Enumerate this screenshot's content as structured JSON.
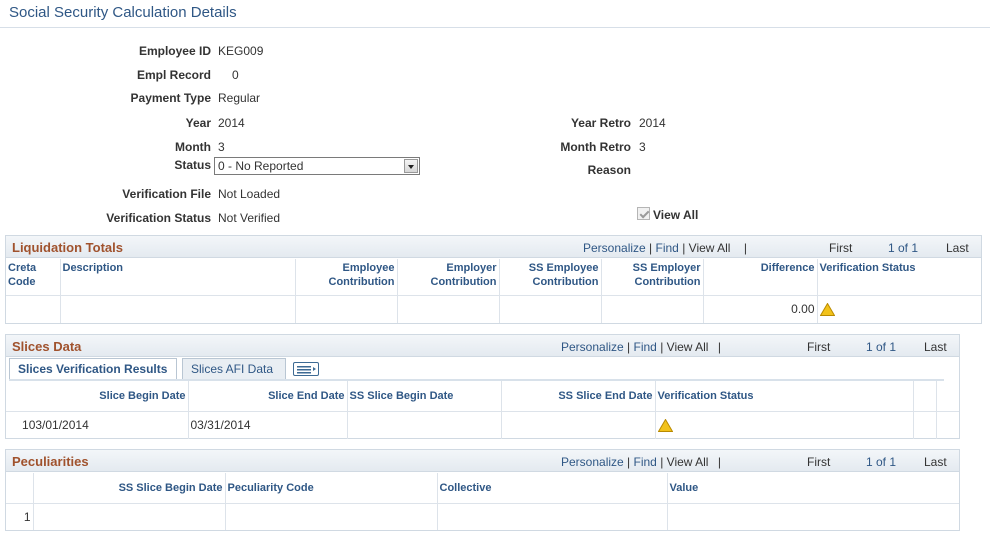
{
  "page": {
    "title": "Social Security Calculation Details"
  },
  "fields": {
    "employee_id_label": "Employee ID",
    "employee_id": "KEG009",
    "empl_record_label": "Empl Record",
    "empl_record": "0",
    "payment_type_label": "Payment Type",
    "payment_type": "Regular",
    "year_label": "Year",
    "year": "2014",
    "month_label": "Month",
    "month": "3",
    "status_label": "Status",
    "status": "0 - No Reported",
    "verification_file_label": "Verification File",
    "verification_file": "Not Loaded",
    "verification_status_label": "Verification Status",
    "verification_status": "Not Verified",
    "year_retro_label": "Year Retro",
    "year_retro": "2014",
    "month_retro_label": "Month Retro",
    "month_retro": "3",
    "reason_label": "Reason",
    "view_all_label": "View All"
  },
  "nav": {
    "personalize": "Personalize",
    "find": "Find",
    "view_all": "View All",
    "first": "First",
    "range": "1 of 1",
    "last": "Last",
    "sep": "|"
  },
  "liquidation": {
    "title": "Liquidation Totals",
    "columns": [
      "Creta Code",
      "Description",
      "Employee Contribution",
      "Employer Contribution",
      "SS Employee Contribution",
      "SS Employer Contribution",
      "Difference",
      "Verification Status"
    ],
    "row": {
      "difference": "0.00",
      "status_icon": "warning-icon"
    }
  },
  "slices": {
    "title": "Slices Data",
    "tabs": [
      "Slices Verification Results",
      "Slices AFI Data"
    ],
    "columns": [
      "Slice Begin Date",
      "Slice End Date",
      "SS Slice Begin Date",
      "SS Slice End Date",
      "Verification Status"
    ],
    "row": {
      "num": "1",
      "begin": "03/01/2014",
      "end": "03/31/2014",
      "status_icon": "warning-icon"
    }
  },
  "peculiarities": {
    "title": "Peculiarities",
    "columns": [
      "SS Slice Begin Date",
      "Peculiarity Code",
      "Collective",
      "Value"
    ],
    "row": {
      "num": "1"
    }
  },
  "colors": {
    "accent": "#2f5785",
    "grid_title": "#a0522d",
    "warning": "#f2c21a"
  }
}
